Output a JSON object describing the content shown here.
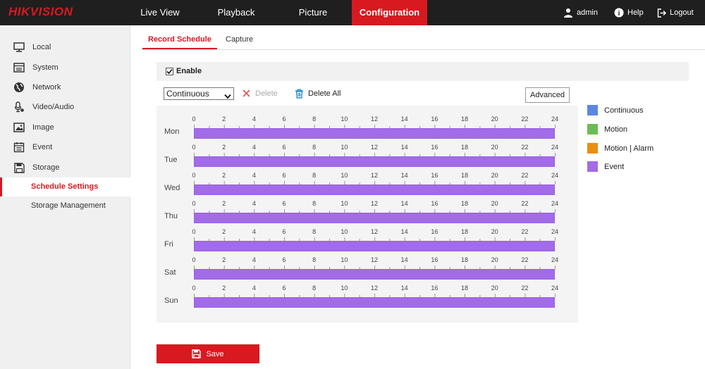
{
  "brand": {
    "logo": "HIKVISION"
  },
  "nav": [
    {
      "label": "Live View",
      "active": false
    },
    {
      "label": "Playback",
      "active": false
    },
    {
      "label": "Picture",
      "active": false
    },
    {
      "label": "Configuration",
      "active": true
    }
  ],
  "user": {
    "name": "admin",
    "help": "Help",
    "logout": "Logout"
  },
  "sidebar": {
    "items": [
      {
        "label": "Local",
        "icon": "monitor-icon"
      },
      {
        "label": "System",
        "icon": "system-icon"
      },
      {
        "label": "Network",
        "icon": "globe-icon"
      },
      {
        "label": "Video/Audio",
        "icon": "microphone-icon"
      },
      {
        "label": "Image",
        "icon": "image-icon"
      },
      {
        "label": "Event",
        "icon": "calendar-icon"
      },
      {
        "label": "Storage",
        "icon": "floppy-disk-icon"
      }
    ],
    "subitems": [
      {
        "label": "Schedule Settings",
        "active": true
      },
      {
        "label": "Storage Management",
        "active": false
      }
    ]
  },
  "tabs": [
    {
      "label": "Record Schedule",
      "active": true
    },
    {
      "label": "Capture",
      "active": false
    }
  ],
  "enable": {
    "label": "Enable",
    "checked": true
  },
  "toolbar": {
    "record_type": "Continuous",
    "delete_label": "Delete",
    "delete_all_label": "Delete All",
    "advanced_label": "Advanced"
  },
  "schedule": {
    "ticks": [
      "0",
      "2",
      "4",
      "6",
      "8",
      "10",
      "12",
      "14",
      "16",
      "18",
      "20",
      "22",
      "24"
    ],
    "days": [
      {
        "name": "Mon",
        "start": 0,
        "end": 24,
        "type": "Event"
      },
      {
        "name": "Tue",
        "start": 0,
        "end": 24,
        "type": "Event"
      },
      {
        "name": "Wed",
        "start": 0,
        "end": 24,
        "type": "Event"
      },
      {
        "name": "Thu",
        "start": 0,
        "end": 24,
        "type": "Event"
      },
      {
        "name": "Fri",
        "start": 0,
        "end": 24,
        "type": "Event"
      },
      {
        "name": "Sat",
        "start": 0,
        "end": 24,
        "type": "Event"
      },
      {
        "name": "Sun",
        "start": 0,
        "end": 24,
        "type": "Event"
      }
    ]
  },
  "legend": [
    {
      "label": "Continuous",
      "color": "#5b87e3"
    },
    {
      "label": "Motion",
      "color": "#6cbc55"
    },
    {
      "label": "Motion | Alarm",
      "color": "#e88f12"
    },
    {
      "label": "Event",
      "color": "#a26be8"
    }
  ],
  "actions": {
    "save_label": "Save"
  },
  "colors": {
    "accent": "#d71920",
    "topbar": "#1f1f1f",
    "event": "#a26be8"
  }
}
